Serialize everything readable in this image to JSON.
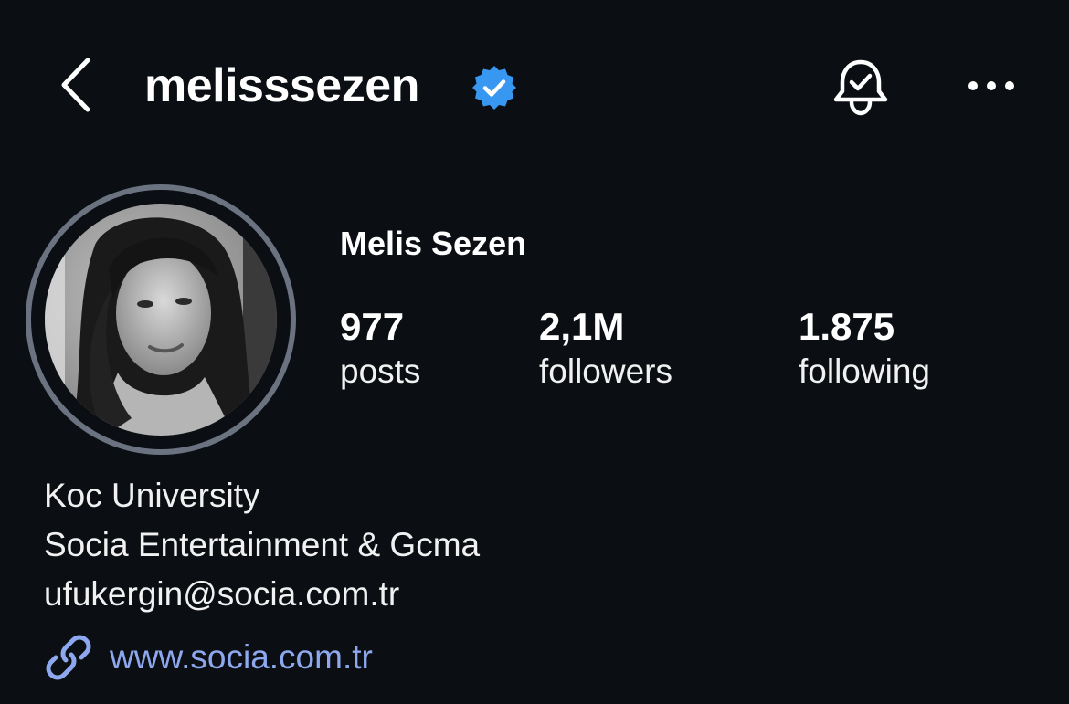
{
  "header": {
    "username": "melisssezen",
    "back_icon": "chevron-left-icon",
    "verified_icon": "verified-badge-icon",
    "bell_icon": "bell-check-icon",
    "more_icon": "more-horizontal-icon"
  },
  "profile": {
    "full_name": "Melis Sezen",
    "stats": {
      "posts": {
        "value": "977",
        "label": "posts"
      },
      "followers": {
        "value": "2,1M",
        "label": "followers"
      },
      "following": {
        "value": "1.875",
        "label": "following"
      }
    },
    "bio": {
      "line1": "Koc University",
      "line2": "Socia Entertainment & Gcma",
      "line3": "ufukergin@socia.com.tr"
    },
    "link": {
      "icon": "link-icon",
      "text": "www.socia.com.tr"
    }
  },
  "colors": {
    "background": "#0b0f14",
    "verified_badge": "#3897f0",
    "link_text": "#8ea8f0",
    "avatar_ring": "#6b7280"
  }
}
